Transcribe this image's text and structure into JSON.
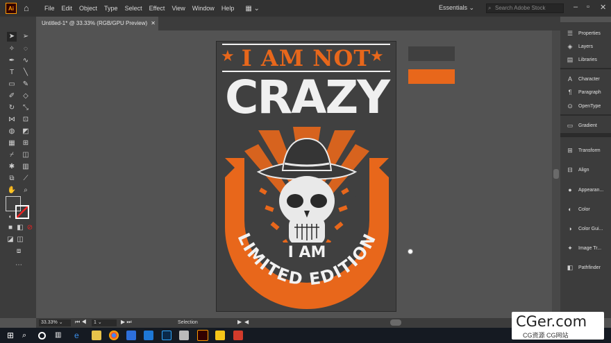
{
  "app": {
    "logo": "Ai",
    "menus": [
      "File",
      "Edit",
      "Object",
      "Type",
      "Select",
      "Effect",
      "View",
      "Window",
      "Help"
    ],
    "workspace": "Essentials",
    "search_placeholder": "Search Adobe Stock"
  },
  "document": {
    "tab_title": "Untitled-1* @ 33.33% (RGB/GPU Preview)"
  },
  "panels": [
    {
      "icon": "properties-icon",
      "label": "Properties"
    },
    {
      "icon": "layers-icon",
      "label": "Layers"
    },
    {
      "icon": "libraries-icon",
      "label": "Libraries"
    },
    {
      "icon": "character-icon",
      "label": "Character"
    },
    {
      "icon": "paragraph-icon",
      "label": "Paragraph"
    },
    {
      "icon": "opentype-icon",
      "label": "OpenType"
    },
    {
      "icon": "gradient-icon",
      "label": "Gradient"
    },
    {
      "icon": "transform-icon",
      "label": "Transform"
    },
    {
      "icon": "align-icon",
      "label": "Align"
    },
    {
      "icon": "appearance-icon",
      "label": "Appearan..."
    },
    {
      "icon": "color-icon",
      "label": "Color"
    },
    {
      "icon": "color-guide-icon",
      "label": "Color Gui..."
    },
    {
      "icon": "image-trace-icon",
      "label": "Image Tr..."
    },
    {
      "icon": "pathfinder-icon",
      "label": "Pathfinder"
    }
  ],
  "status": {
    "zoom": "33.33%",
    "artboard_number": "1",
    "tool_name": "Selection"
  },
  "artwork": {
    "line1": "I AM NOT",
    "line2": "CRAZY",
    "line3": "I AM",
    "line4": "LIMITED EDITION",
    "colors": {
      "orange": "#e8671b",
      "dark": "#404040",
      "white": "#f2f2f2"
    }
  },
  "watermark": {
    "site": "CGer.com",
    "subtitle": "CG资源 CG网站"
  },
  "colors": {
    "menubar": "#323232",
    "panel": "#3c3c3c",
    "canvas": "#535353",
    "accent_orange": "#e8671b",
    "swatch_dark": "#404040"
  }
}
